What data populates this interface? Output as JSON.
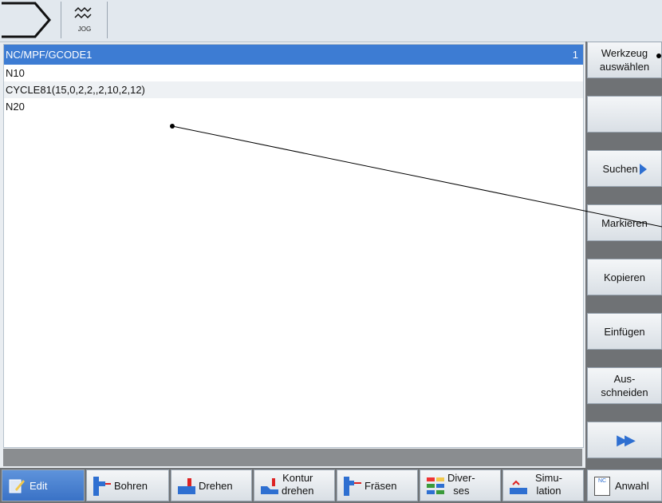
{
  "topbar": {
    "jog_label": "JOG",
    "mode_icon": "machine-area-icon",
    "jog_icon": "jog-wave-icon"
  },
  "editor": {
    "path": "NC/MPF/GCODE1",
    "channel": "1",
    "lines": [
      "N10",
      "CYCLE81(15,0,2,2,,2,10,2,12)",
      "N20"
    ]
  },
  "vertical_softkeys": {
    "werkzeug_line1": "Werkzeug",
    "werkzeug_line2": "auswählen",
    "suchen": "Suchen",
    "markieren": "Markieren",
    "kopieren": "Kopieren",
    "einfuegen": "Einfügen",
    "ausschneiden_line1": "Aus-",
    "ausschneiden_line2": "schneiden",
    "more_icon": "double-arrow-right-icon"
  },
  "horizontal_softkeys": {
    "edit": "Edit",
    "bohren": "Bohren",
    "drehen": "Drehen",
    "kontur_line1": "Kontur",
    "kontur_line2": "drehen",
    "fraesen": "Fräsen",
    "divers_line1": "Diver-",
    "divers_line2": "ses",
    "simu_line1": "Simu-",
    "simu_line2": "lation",
    "anwahl": "Anwahl",
    "anwahl_badge": "NC"
  },
  "colors": {
    "title_bar": "#3d7cd3",
    "accent_arrow": "#2e6fd1",
    "active_key": "#3a72c6",
    "panel_gray": "#6f7275"
  }
}
